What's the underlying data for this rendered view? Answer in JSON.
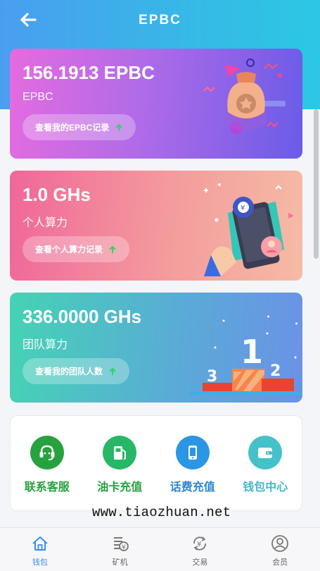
{
  "header": {
    "title": "EPBC"
  },
  "cards": [
    {
      "value": "156.1913 EPBC",
      "label": "EPBC",
      "button": "查看我的EPBC记录"
    },
    {
      "value": "1.0 GHs",
      "label": "个人算力",
      "button": "查看个人算力记录"
    },
    {
      "value": "336.0000 GHs",
      "label": "团队算力",
      "button": "查看我的团队人数"
    }
  ],
  "quick_actions": [
    {
      "label": "联系客服",
      "icon": "headset-icon",
      "color": "#27a23f"
    },
    {
      "label": "油卡充值",
      "icon": "fuel-pump-icon",
      "color": "#27a23f"
    },
    {
      "label": "话费充值",
      "icon": "phone-icon",
      "color": "#2b86d6"
    },
    {
      "label": "钱包中心",
      "icon": "wallet-icon",
      "color": "#46b8c7"
    }
  ],
  "watermark": "www.tiaozhuan.net",
  "tabbar": [
    {
      "label": "钱包",
      "icon": "home-icon",
      "active": true
    },
    {
      "label": "矿机",
      "icon": "miner-icon",
      "active": false
    },
    {
      "label": "交易",
      "icon": "exchange-icon",
      "active": false
    },
    {
      "label": "会员",
      "icon": "user-icon",
      "active": false
    }
  ],
  "colors": {
    "header": "#3fb0ea",
    "accent": "#3b8ef0",
    "arrow": "#2fd16a"
  }
}
